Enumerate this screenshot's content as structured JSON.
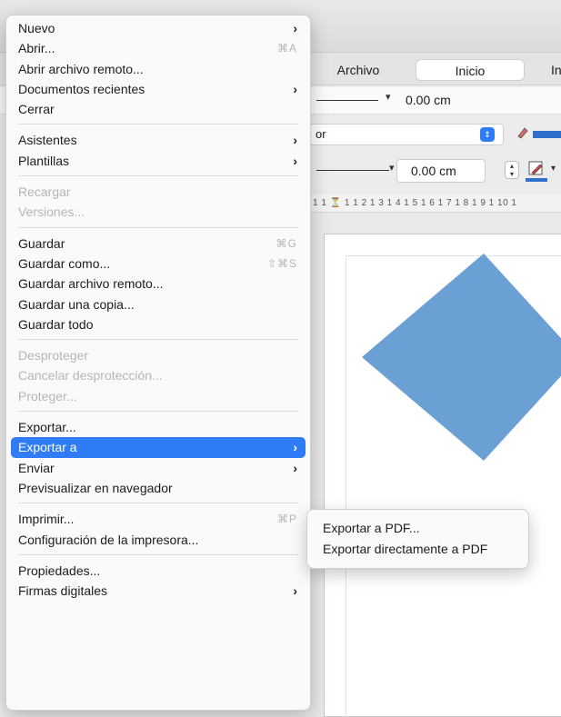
{
  "app": {
    "tabs": [
      "Archivo",
      "Inicio",
      "In"
    ],
    "toolbar": {
      "line_width_1": "0.00 cm",
      "area_field": "or",
      "line_width_2": "0.00 cm"
    },
    "ruler_text": "1 1 ⏳ 1 1 2 1 3 1 4 1 5 1 6 1 7 1 8 1 9 1 10 1",
    "shape_color": "#6aa0d4"
  },
  "menu": {
    "items": [
      {
        "label": "Nuevo",
        "arrow": "›"
      },
      {
        "label": "Abrir...",
        "shortcut": "⌘A"
      },
      {
        "label": "Abrir archivo remoto..."
      },
      {
        "label": "Documentos recientes",
        "arrow": "›"
      },
      {
        "label": "Cerrar"
      },
      {
        "label": "Asistentes",
        "arrow": "›"
      },
      {
        "label": "Plantillas",
        "arrow": "›"
      },
      {
        "label": "Recargar"
      },
      {
        "label": "Versiones..."
      },
      {
        "label": "Guardar",
        "shortcut": "⌘G"
      },
      {
        "label": "Guardar como...",
        "shortcut": "⇧⌘S"
      },
      {
        "label": "Guardar archivo remoto..."
      },
      {
        "label": "Guardar una copia..."
      },
      {
        "label": "Guardar todo"
      },
      {
        "label": "Desproteger"
      },
      {
        "label": "Cancelar desprotección..."
      },
      {
        "label": "Proteger..."
      },
      {
        "label": "Exportar..."
      },
      {
        "label": "Exportar a",
        "arrow": "›"
      },
      {
        "label": "Enviar",
        "arrow": "›"
      },
      {
        "label": "Previsualizar en navegador"
      },
      {
        "label": "Imprimir...",
        "shortcut": "⌘P"
      },
      {
        "label": "Configuración de la impresora..."
      },
      {
        "label": "Propiedades..."
      },
      {
        "label": "Firmas digitales",
        "arrow": "›"
      }
    ]
  },
  "submenu": {
    "items": [
      {
        "label": "Exportar a PDF..."
      },
      {
        "label": "Exportar directamente a PDF"
      }
    ]
  },
  "colors": {
    "highlight": "#2f7cf6",
    "disabled_text": "#b5b5b5"
  }
}
